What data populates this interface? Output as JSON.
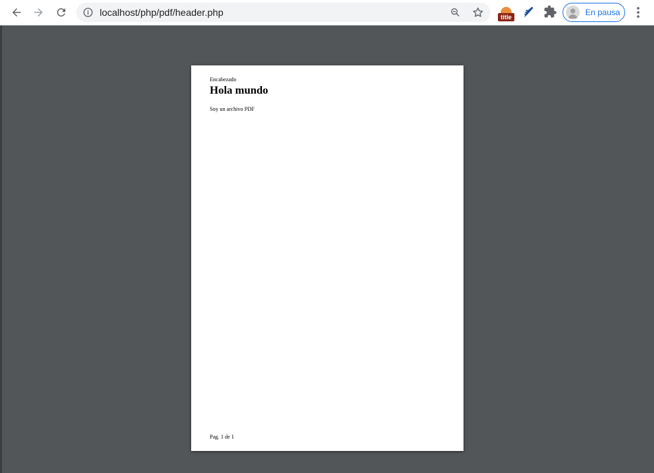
{
  "browser": {
    "url": "localhost/php/pdf/header.php",
    "profile_label": "En pausa",
    "extension_badge": "title"
  },
  "pdf": {
    "header": "Encabezado",
    "title": "Hola mundo",
    "body": "Soy un archivo PDF",
    "footer": "Pag. 1 de 1"
  },
  "icons": [
    "back-icon",
    "forward-icon",
    "reload-icon",
    "info-icon",
    "zoom-icon",
    "star-icon",
    "title-extension-icon",
    "pen-extension-icon",
    "puzzle-icon",
    "avatar-icon",
    "more-icon"
  ],
  "colors": {
    "viewer_bg": "#525659",
    "accent": "#1a73e8",
    "omnibox_bg": "#f1f3f4"
  }
}
